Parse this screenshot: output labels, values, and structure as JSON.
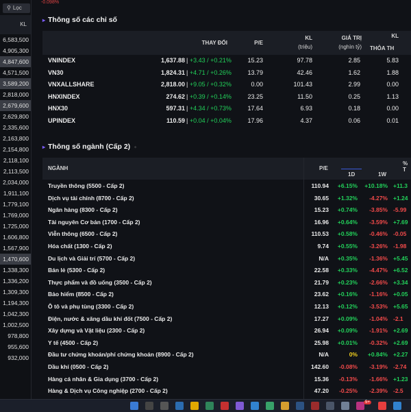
{
  "top_strip": [
    "-0.098%"
  ],
  "filter": {
    "label": "Lọc"
  },
  "kl_header": "KL",
  "kl_values": [
    "6,583,500",
    "4,905,300",
    "4,847,600",
    "4,571,500",
    "3,589,200",
    "2,818,000",
    "2,679,600",
    "2,629,800",
    "2,335,600",
    "2,163,800",
    "2,154,800",
    "2,118,100",
    "2,113,500",
    "2,034,000",
    "1,911,100",
    "1,779,100",
    "1,769,000",
    "1,725,000",
    "1,606,800",
    "1,567,900",
    "1,470,600",
    "1,338,300",
    "1,336,200",
    "1,309,300",
    "1,194,300",
    "1,042,300",
    "1,002,500",
    "978,800",
    "955,600",
    "932,000"
  ],
  "indices": {
    "title": "Thông số các chỉ số",
    "headers": {
      "change": "THAY ĐỔI",
      "pe": "P/E",
      "kl": "KL",
      "kl_unit": "(triệu)",
      "value": "GIÁ TRỊ",
      "value_unit": "(nghìn tỷ)",
      "kl2": "KL",
      "matched": "THỎA TH"
    },
    "rows": [
      {
        "name": "VNINDEX",
        "price": "1,637.88",
        "change": "+3.43 / +0.21%",
        "pe": "15.23",
        "kl": "97.78",
        "value": "2.85",
        "matched": "5.83"
      },
      {
        "name": "VN30",
        "price": "1,824.31",
        "change": "+4.71 / +0.26%",
        "pe": "13.79",
        "kl": "42.46",
        "value": "1.62",
        "matched": "1.88"
      },
      {
        "name": "VNXALLSHARE",
        "price": "2,818.00",
        "change": "+9.05 / +0.32%",
        "pe": "0.00",
        "kl": "101.43",
        "value": "2.99",
        "matched": "0.00"
      },
      {
        "name": "HNXINDEX",
        "price": "274.62",
        "change": "+0.39 / +0.14%",
        "pe": "23.25",
        "kl": "11.50",
        "value": "0.25",
        "matched": "1.13"
      },
      {
        "name": "HNX30",
        "price": "597.31",
        "change": "+4.34 / +0.73%",
        "pe": "17.64",
        "kl": "6.93",
        "value": "0.18",
        "matched": "0.00"
      },
      {
        "name": "UPINDEX",
        "price": "110.59",
        "change": "+0.04 / +0.04%",
        "pe": "17.96",
        "kl": "4.37",
        "value": "0.06",
        "matched": "0.01"
      }
    ]
  },
  "sectors": {
    "title": "Thông số ngành (Cấp 2)",
    "headers": {
      "name": "NGÀNH",
      "pe": "P/E",
      "d1": "1D",
      "w1": "1W",
      "pct": "% T"
    },
    "rows": [
      {
        "name": "Truyền thông (5500 - Cấp 2)",
        "pe": "110.94",
        "d1": "+6.15%",
        "d1c": "green",
        "w1": "+10.18%",
        "w1c": "green",
        "m1": "+11.3",
        "m1c": "green"
      },
      {
        "name": "Dịch vụ tài chính (8700 - Cấp 2)",
        "pe": "30.65",
        "d1": "+1.32%",
        "d1c": "green",
        "w1": "-4.27%",
        "w1c": "red",
        "m1": "+1.24",
        "m1c": "green"
      },
      {
        "name": "Ngân hàng (8300 - Cấp 2)",
        "pe": "15.23",
        "d1": "+0.74%",
        "d1c": "green",
        "w1": "-3.85%",
        "w1c": "red",
        "m1": "-5.99",
        "m1c": "red"
      },
      {
        "name": "Tài nguyên Cơ bản (1700 - Cấp 2)",
        "pe": "16.96",
        "d1": "+0.64%",
        "d1c": "green",
        "w1": "-3.59%",
        "w1c": "red",
        "m1": "+7.69",
        "m1c": "green"
      },
      {
        "name": "Viễn thông (6500 - Cấp 2)",
        "pe": "110.53",
        "d1": "+0.58%",
        "d1c": "green",
        "w1": "-0.46%",
        "w1c": "red",
        "m1": "-0.05",
        "m1c": "red"
      },
      {
        "name": "Hóa chất (1300 - Cấp 2)",
        "pe": "9.74",
        "d1": "+0.55%",
        "d1c": "green",
        "w1": "-3.26%",
        "w1c": "red",
        "m1": "-1.98",
        "m1c": "red"
      },
      {
        "name": "Du lịch và Giải trí (5700 - Cấp 2)",
        "pe": "N/A",
        "d1": "+0.35%",
        "d1c": "green",
        "w1": "-1.36%",
        "w1c": "red",
        "m1": "+5.45",
        "m1c": "green"
      },
      {
        "name": "Bán lẻ (5300 - Cấp 2)",
        "pe": "22.58",
        "d1": "+0.33%",
        "d1c": "green",
        "w1": "-4.47%",
        "w1c": "red",
        "m1": "+6.52",
        "m1c": "green"
      },
      {
        "name": "Thực phẩm và đồ uống (3500 - Cấp 2)",
        "pe": "21.79",
        "d1": "+0.23%",
        "d1c": "green",
        "w1": "-2.66%",
        "w1c": "red",
        "m1": "+3.34",
        "m1c": "green"
      },
      {
        "name": "Bảo hiểm (8500 - Cấp 2)",
        "pe": "23.62",
        "d1": "+0.16%",
        "d1c": "green",
        "w1": "-1.16%",
        "w1c": "red",
        "m1": "+0.05",
        "m1c": "green"
      },
      {
        "name": "Ô tô và phụ tùng (3300 - Cấp 2)",
        "pe": "12.13",
        "d1": "+0.12%",
        "d1c": "green",
        "w1": "-3.53%",
        "w1c": "red",
        "m1": "+5.65",
        "m1c": "green"
      },
      {
        "name": "Điện, nước & xăng dầu khí đốt (7500 - Cấp 2)",
        "pe": "17.27",
        "d1": "+0.09%",
        "d1c": "green",
        "w1": "-1.04%",
        "w1c": "red",
        "m1": "-2.1",
        "m1c": "red"
      },
      {
        "name": "Xây dựng và Vật liệu (2300 - Cấp 2)",
        "pe": "26.94",
        "d1": "+0.09%",
        "d1c": "green",
        "w1": "-1.91%",
        "w1c": "red",
        "m1": "+2.69",
        "m1c": "green"
      },
      {
        "name": "Y tế (4500 - Cấp 2)",
        "pe": "25.98",
        "d1": "+0.01%",
        "d1c": "green",
        "w1": "-0.32%",
        "w1c": "red",
        "m1": "+2.69",
        "m1c": "green"
      },
      {
        "name": "Đầu tư chứng khoán/phí chứng khoán (8900 - Cấp 2)",
        "pe": "N/A",
        "d1": "0%",
        "d1c": "yellow",
        "w1": "+0.84%",
        "w1c": "green",
        "m1": "+2.27",
        "m1c": "green"
      },
      {
        "name": "Dầu khí (0500 - Cấp 2)",
        "pe": "142.60",
        "d1": "-0.08%",
        "d1c": "red",
        "w1": "-3.19%",
        "w1c": "red",
        "m1": "-2.74",
        "m1c": "red"
      },
      {
        "name": "Hàng cá nhân & Gia dụng (3700 - Cấp 2)",
        "pe": "15.36",
        "d1": "-0.13%",
        "d1c": "red",
        "w1": "-1.66%",
        "w1c": "red",
        "m1": "+1.23",
        "m1c": "green"
      },
      {
        "name": "Hàng & Dịch vụ Công nghiệp (2700 - Cấp 2)",
        "pe": "47.20",
        "d1": "-0.25%",
        "d1c": "red",
        "w1": "-2.39%",
        "w1c": "red",
        "m1": "-2.5",
        "m1c": "red"
      }
    ]
  },
  "taskbar": {
    "badge": "5+"
  },
  "colors": {
    "up": "#22d15a",
    "down": "#f24a4a",
    "flat": "#f5d21e",
    "accent": "#7c5cff"
  }
}
